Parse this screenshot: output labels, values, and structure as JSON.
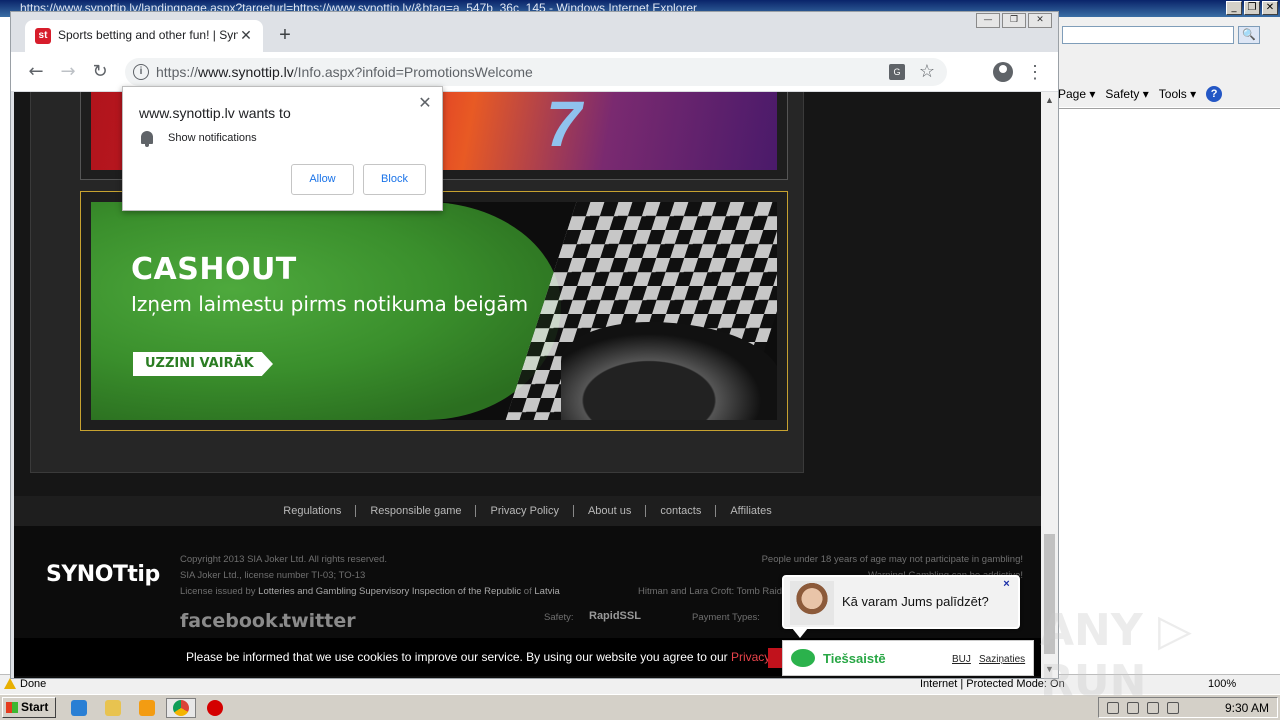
{
  "ie": {
    "title": "https://www.synottip.lv/landingpage.aspx?targeturl=https://www.synottip.lv/&btag=a_547b_36c_145 - Windows Internet Explorer",
    "win_buttons": [
      "_",
      "❐",
      "✕"
    ],
    "search_icon": "🔍",
    "menu": [
      "Page ▾",
      "Safety ▾",
      "Tools ▾"
    ],
    "help_label": "?",
    "status_text": "Done",
    "zone_text": "Internet | Protected Mode: On",
    "zoom": "100%"
  },
  "taskbar": {
    "start_label": "Start",
    "time": "9:30 AM"
  },
  "chrome": {
    "tab_title": "Sports betting and other fun! | Synot",
    "favicon_text": "st",
    "tab_close": "✕",
    "new_tab": "+",
    "url_scheme": "https://",
    "url_host": "www.synottip.lv",
    "url_path": "/Info.aspx?infoid=PromotionsWelcome",
    "back": "←",
    "forward": "→",
    "reload": "↻",
    "star": "☆",
    "menu": "⋮",
    "win_buttons": [
      "—",
      "❐",
      "✕"
    ]
  },
  "notification": {
    "title": "www.synottip.lv wants to",
    "permission": "Show notifications",
    "allow": "Allow",
    "block": "Block",
    "close": "✕"
  },
  "promo": {
    "cashout_title": "CASHOUT",
    "cashout_subtitle": "Izņem laimestu pirms notikuma beigām",
    "cashout_cta": "UZZINI VAIRĀK"
  },
  "footer": {
    "links": [
      "Regulations",
      "Responsible game",
      "Privacy Policy",
      "About us",
      "contacts",
      "Affiliates"
    ],
    "logo": "SYNOTtip",
    "copyright": "Copyright 2013 SIA Joker Ltd. All rights reserved.",
    "license": "SIA Joker Ltd., license number TI-03; TO-13",
    "license_issued_prefix": "License issued by",
    "license_authority": "Lotteries and Gambling Supervisory Inspection of the Republic",
    "license_of": "of",
    "license_country": "Latvia",
    "age_warning": "People under 18 years of age may not participate in gambling!",
    "addiction_warning": "Warning! Gambling can be addictive!",
    "trademark_note": "Hitman and Lara Croft: Tomb Raider",
    "safety_label": "Safety:",
    "ssl_label": "RapidSSL",
    "payment_label": "Payment Types:",
    "facebook": "facebook.",
    "twitter": "twitter"
  },
  "cookie": {
    "text": "Please be informed that we use cookies to improve our service. By using our website you agree to our ",
    "link": "Privacy Policy"
  },
  "chat": {
    "question": "Kā varam Jums palīdzēt?",
    "close": "×",
    "status": "Tiešsaistē",
    "faq": "BUJ",
    "contacts": "Saziņaties"
  },
  "watermark": "ANY ▷ RUN"
}
